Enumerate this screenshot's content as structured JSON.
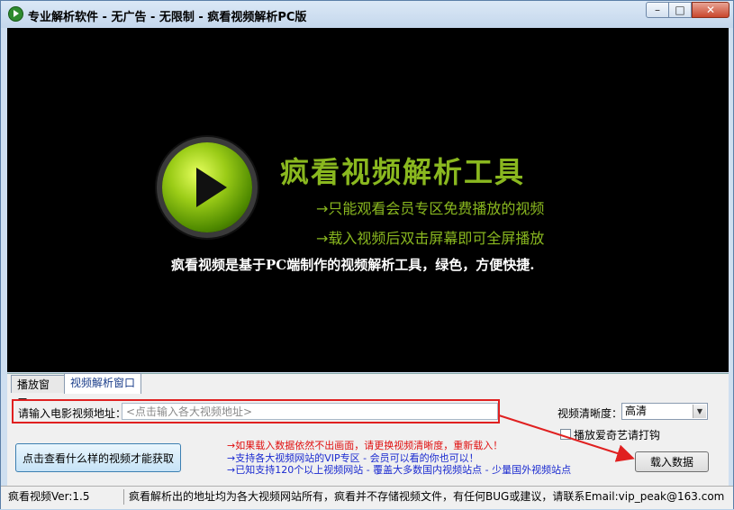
{
  "window": {
    "title": "专业解析软件 - 无广告 - 无限制 - 疯看视频解析PC版",
    "controls": {
      "minimize": "–",
      "maximize": "□",
      "close": "✕"
    }
  },
  "player": {
    "headline": "疯看视频解析工具",
    "line1": "→只能观看会员专区免费播放的视频",
    "line2": "→载入视频后双击屏幕即可全屏播放",
    "description": "疯看视频是基于PC端制作的视频解析工具，绿色，方便快捷."
  },
  "tabs": [
    {
      "label": "播放窗口"
    },
    {
      "label": "视频解析窗口"
    }
  ],
  "form": {
    "url_label": "请输入电影视频地址：",
    "url_placeholder": "<点击输入各大视频地址>",
    "url_value": "",
    "quality_label": "视频清晰度：",
    "quality_value": "高清",
    "iqiyi_checkbox_label": "播放爱奇艺请打钩",
    "iqiyi_checked": false,
    "howto_button": "点击查看什么样的视频才能获取",
    "load_button": "载入数据"
  },
  "notes": {
    "warning": "→如果载入数据依然不出画面，请更换视频清晰度，重新载入！",
    "vip": "→支持各大视频网站的VIP专区 - 会员可以看的你也可以！",
    "support": "→已知支持120个以上视频网站 - 覆盖大多数国内视频站点 - 少量国外视频站点"
  },
  "status": {
    "version": "疯看视频Ver:1.5",
    "message": "疯看解析出的地址均为各大视频网站所有，疯看并不存储视频文件，有任何BUG或建议，请联系Email:vip_peak@163.com"
  },
  "colors": {
    "accent_green": "#8ab81f",
    "highlight_red": "#e02020",
    "note_blue": "#1a2ad0"
  }
}
